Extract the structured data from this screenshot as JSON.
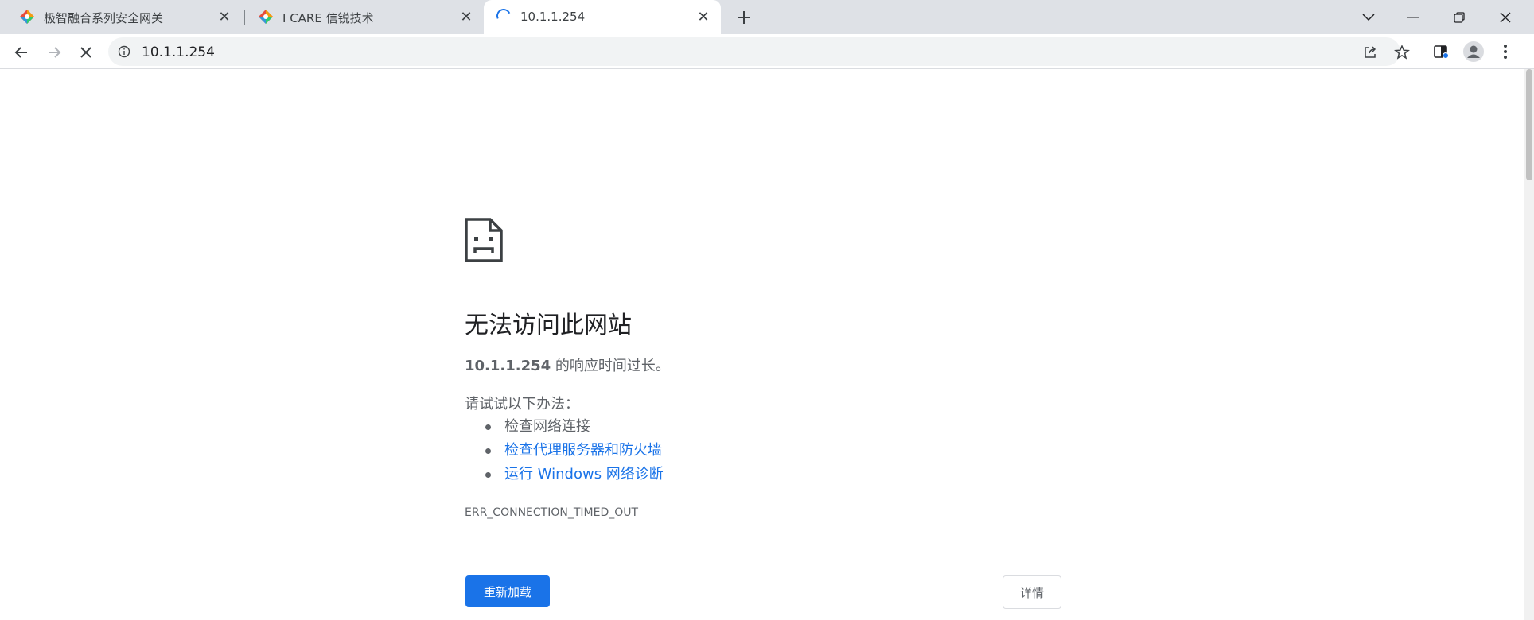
{
  "tabs": [
    {
      "title": "极智融合系列安全网关",
      "favicon": "brand-diamond-icon"
    },
    {
      "title": "I CARE 信锐技术",
      "favicon": "brand-diamond-icon"
    },
    {
      "title": "10.1.1.254",
      "favicon": "loading-spinner-icon"
    }
  ],
  "toolbar": {
    "url": "10.1.1.254"
  },
  "error": {
    "title": "无法访问此网站",
    "summary_host": "10.1.1.254",
    "summary_text": " 的响应时间过长。",
    "try_label": "请试试以下办法：",
    "suggestions": [
      "检查网络连接",
      "检查代理服务器和防火墙",
      "运行 Windows 网络诊断"
    ],
    "code": "ERR_CONNECTION_TIMED_OUT",
    "reload_label": "重新加载",
    "details_label": "详情"
  },
  "colors": {
    "accent": "#1a73e8",
    "tabstrip": "#dee1e6",
    "text_secondary": "#5f6368"
  }
}
